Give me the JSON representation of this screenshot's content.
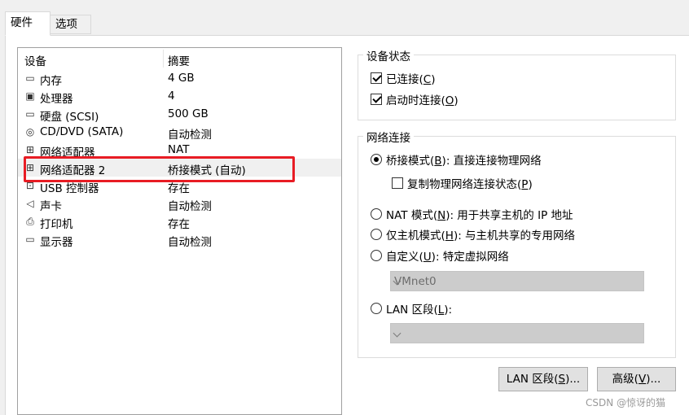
{
  "tabs": [
    {
      "label": "硬件",
      "active": true
    },
    {
      "label": "选项",
      "active": false
    }
  ],
  "device_list": {
    "header_device": "设备",
    "header_summary": "摘要",
    "rows": [
      {
        "icon": "memory-icon",
        "name": "内存",
        "summary": "4 GB"
      },
      {
        "icon": "cpu-icon",
        "name": "处理器",
        "summary": "4"
      },
      {
        "icon": "hard-disk-icon",
        "name": "硬盘 (SCSI)",
        "summary": "500 GB"
      },
      {
        "icon": "cd-dvd-icon",
        "name": "CD/DVD (SATA)",
        "summary": "自动检测"
      },
      {
        "icon": "network-adapter-icon",
        "name": "网络适配器",
        "summary": "NAT"
      },
      {
        "icon": "network-adapter-icon",
        "name": "网络适配器 2",
        "summary": "桥接模式 (自动)",
        "selected": true
      },
      {
        "icon": "usb-icon",
        "name": "USB 控制器",
        "summary": "存在"
      },
      {
        "icon": "speaker-icon",
        "name": "声卡",
        "summary": "自动检测"
      },
      {
        "icon": "printer-icon",
        "name": "打印机",
        "summary": "存在"
      },
      {
        "icon": "monitor-icon",
        "name": "显示器",
        "summary": "自动检测"
      }
    ]
  },
  "device_status": {
    "title": "设备状态",
    "connected": {
      "pre": "已连接(",
      "key": "C",
      "post": ")",
      "checked": true
    },
    "connect_on_start": {
      "pre": "启动时连接(",
      "key": "O",
      "post": ")",
      "checked": true
    }
  },
  "network": {
    "title": "网络连接",
    "bridged": {
      "pre": "桥接模式(",
      "key": "B",
      "post": "): 直接连接物理网络",
      "selected": true
    },
    "replicate": {
      "pre": "复制物理网络连接状态(",
      "key": "P",
      "post": ")",
      "checked": false
    },
    "nat": {
      "pre": "NAT 模式(",
      "key": "N",
      "post": "): 用于共享主机的 IP 地址",
      "selected": false
    },
    "hostonly": {
      "pre": "仅主机模式(",
      "key": "H",
      "post": "): 与主机共享的专用网络",
      "selected": false
    },
    "custom": {
      "pre": "自定义(",
      "key": "U",
      "post": "): 特定虚拟网络",
      "selected": false
    },
    "custom_value": "VMnet0",
    "lan": {
      "pre": "LAN 区段(",
      "key": "L",
      "post": "):",
      "selected": false
    },
    "lan_value": ""
  },
  "buttons": {
    "lan_segments": {
      "pre": "LAN 区段(",
      "key": "S",
      "post": ")..."
    },
    "advanced": {
      "pre": "高级(",
      "key": "V",
      "post": ")..."
    }
  },
  "watermark": "CSDN @惊讶的猫",
  "colors": {
    "highlight_border": "#e81c24",
    "disabled_combo": "#cccccc"
  }
}
